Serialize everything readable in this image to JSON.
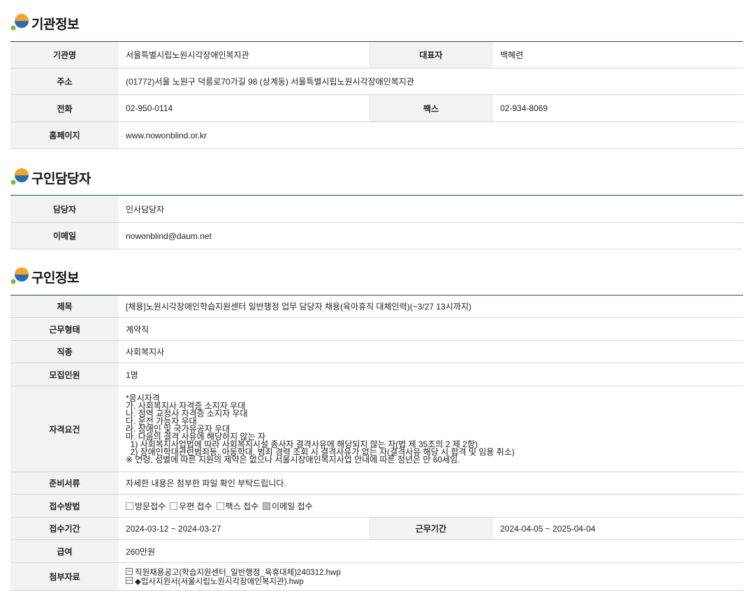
{
  "sections": {
    "org": {
      "title": "기관정보",
      "rows": {
        "name_label": "기관명",
        "name_value": "서울특별시립노원시각장애인복지관",
        "rep_label": "대표자",
        "rep_value": "백혜련",
        "addr_label": "주소",
        "addr_value": "(01772)서울 노원구 덕릉로70가길 98 (상계동) 서울특별시립노원시각장애인복지관",
        "tel_label": "전화",
        "tel_value": "02-950-0114",
        "fax_label": "팩스",
        "fax_value": "02-934-8069",
        "home_label": "홈페이지",
        "home_value": "www.nowonblind.or.kr"
      }
    },
    "contact": {
      "title": "구인담당자",
      "rows": {
        "person_label": "담당자",
        "person_value": "인사담당자",
        "email_label": "이메일",
        "email_value": "nowonblind@daum.net"
      }
    },
    "job": {
      "title": "구인정보",
      "rows": {
        "title_label": "제목",
        "title_value": "[채용]노원시각장애인학습지원센터 일반행정 업무 담당자 채용(육아휴직 대체인력)(~3/27 13시까지)",
        "type_label": "근무형태",
        "type_value": "계약직",
        "job_label": "직종",
        "job_value": "사회복지사",
        "count_label": "모집인원",
        "count_value": "1명",
        "qual_label": "자격요건",
        "qual_lines": [
          "*응시자격",
          "가. 사회복지사 자격증 소지자 우대",
          "나. 점역 교정사 자격증 소지자 우대",
          "다. 운전 가능자 우대",
          "라. 장애인 및 국가유공자 우대",
          "마. 다음의 결격 사유에 해당하지 않는 자",
          "  1) 사회복지사업법에 따라 사회복지시설 종사자 결격사유에 해당되지 않는 자(법 제 35조의 2 제 2항)",
          "  2) 장애인학대관련범죄등, 아동학대, 범죄 경력 조회 시 결격사유가 없는 자(결격사유 해당 시 합격 및 임용 취소)",
          "※ 연령, 성별에 따른 지원의 제약은 없으나 서울시장애인복지사업 안내에 따른 정년은 만 60세임."
        ],
        "docs_label": "준비서류",
        "docs_value": "자세한 내용은 첨부한 파일 확인 부탁드립니다.",
        "method_label": "접수방법",
        "methods": [
          {
            "label": "방문접수",
            "checked": false
          },
          {
            "label": "우편 접수",
            "checked": false
          },
          {
            "label": "팩스 접수",
            "checked": false
          },
          {
            "label": "이메일 접수",
            "checked": true
          }
        ],
        "period_label": "접수기간",
        "period_value": "2024-03-12 ~ 2024-03-27",
        "work_label": "근무기간",
        "work_value": "2024-04-05 ~ 2025-04-04",
        "pay_label": "급여",
        "pay_value": "260만원",
        "attach_label": "첨부자료",
        "attachments": [
          "직원채용공고(학습지원센터_일반행정_육휴대체)240312.hwp",
          "◆입사지원서(서울시립노원시각장애인복지관).hwp"
        ]
      }
    }
  },
  "colors": {
    "header_line": "#2b4a6a",
    "label_bg": "#f2f2f2",
    "icon_orange": "#f5a623",
    "icon_blue": "#2a6db5",
    "icon_green": "#7dbb2f"
  }
}
